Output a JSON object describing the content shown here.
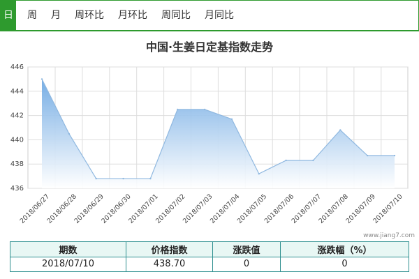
{
  "tabs": [
    "日",
    "周",
    "月",
    "周环比",
    "月环比",
    "周同比",
    "月同比"
  ],
  "active_tab": 0,
  "colors": {
    "tab_green": "#2e9a2e",
    "line": "#8fb8e0",
    "area_top": "#6fa9e3",
    "table_border": "#2e8f8f"
  },
  "chart_data": {
    "type": "area",
    "title": "中国·生姜日定基指数走势",
    "categories": [
      "2018/06/27",
      "2018/06/28",
      "2018/06/29",
      "2018/06/30",
      "2018/07/01",
      "2018/07/02",
      "2018/07/03",
      "2018/07/04",
      "2018/07/05",
      "2018/07/06",
      "2018/07/07",
      "2018/07/08",
      "2018/07/09",
      "2018/07/10"
    ],
    "series": [
      {
        "values": [
          445.0,
          440.5,
          436.8,
          436.8,
          436.8,
          442.5,
          442.5,
          441.7,
          437.2,
          438.3,
          438.3,
          440.8,
          438.7,
          438.7
        ]
      }
    ],
    "ylim": [
      436,
      446
    ],
    "yticks": [
      436,
      438,
      440,
      442,
      444,
      446
    ],
    "grid": true,
    "xlabel": "",
    "ylabel": ""
  },
  "watermark": "www.jiang7.com",
  "table": {
    "headers": [
      "期数",
      "价格指数",
      "涨跌值",
      "涨跌幅（%）"
    ],
    "row": [
      "2018/07/10",
      "438.70",
      "0",
      "0"
    ]
  }
}
